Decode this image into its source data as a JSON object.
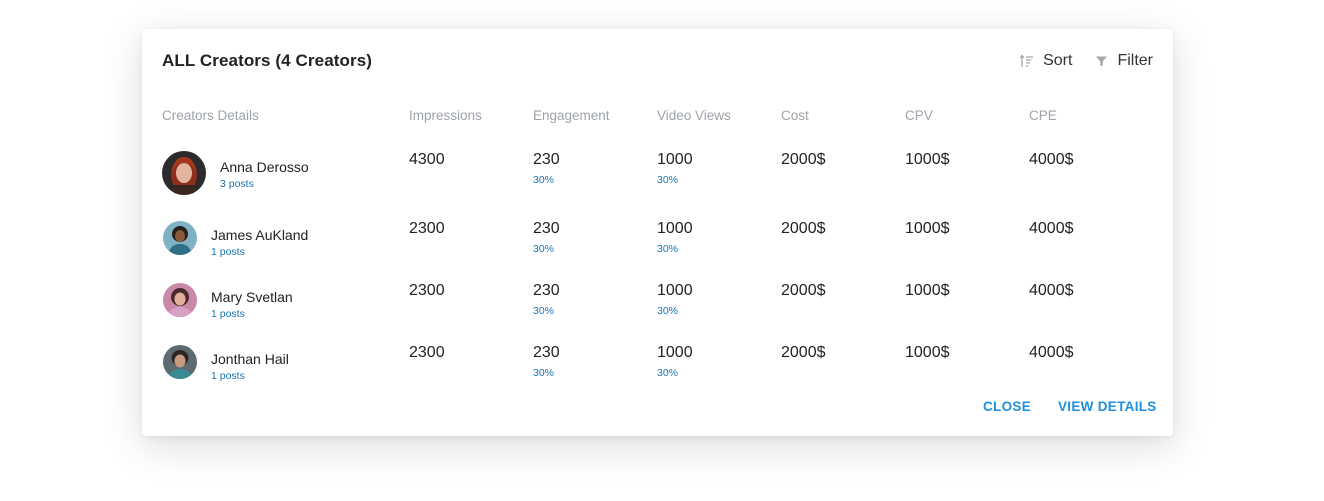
{
  "modal": {
    "title": "ALL Creators (4 Creators)",
    "sort_label": "Sort",
    "filter_label": "Filter",
    "close_label": "CLOSE",
    "view_details_label": "VIEW DETAILS"
  },
  "columns": [
    "Creators Details",
    "Impressions",
    "Engagement",
    "Video Views",
    "Cost",
    "CPV",
    "CPE"
  ],
  "rows": [
    {
      "name": "Anna Derosso",
      "posts": "3 posts",
      "impressions": "4300",
      "engagement": "230",
      "engagement_pct": "30%",
      "video_views": "1000",
      "video_views_pct": "30%",
      "cost": "2000$",
      "cpv": "1000$",
      "cpe": "4000$"
    },
    {
      "name": "James AuKland",
      "posts": "1 posts",
      "impressions": "2300",
      "engagement": "230",
      "engagement_pct": "30%",
      "video_views": "1000",
      "video_views_pct": "30%",
      "cost": "2000$",
      "cpv": "1000$",
      "cpe": "4000$"
    },
    {
      "name": "Mary Svetlan",
      "posts": "1 posts",
      "impressions": "2300",
      "engagement": "230",
      "engagement_pct": "30%",
      "video_views": "1000",
      "video_views_pct": "30%",
      "cost": "2000$",
      "cpv": "1000$",
      "cpe": "4000$"
    },
    {
      "name": "Jonthan Hail",
      "posts": "1 posts",
      "impressions": "2300",
      "engagement": "230",
      "engagement_pct": "30%",
      "video_views": "1000",
      "video_views_pct": "30%",
      "cost": "2000$",
      "cpv": "1000$",
      "cpe": "4000$"
    }
  ],
  "colors": {
    "accent": "#1e90e0",
    "link": "#1a73b0",
    "muted": "#9ea3a9"
  }
}
